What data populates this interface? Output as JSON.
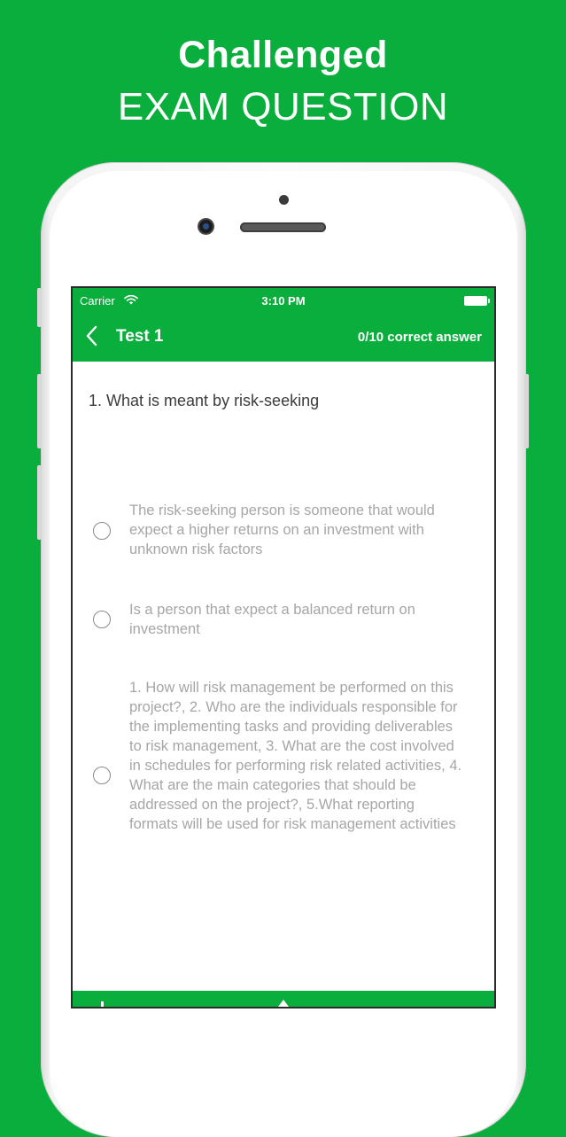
{
  "promo": {
    "line1": "Challenged",
    "line2": "EXAM QUESTION"
  },
  "status_bar": {
    "carrier": "Carrier",
    "time": "3:10 PM",
    "icons": [
      "wifi-icon",
      "battery-icon"
    ]
  },
  "nav": {
    "back_icon": "chevron-left-icon",
    "title": "Test 1",
    "score": "0/10 correct answer"
  },
  "question": {
    "text": "1. What is meant by risk-seeking"
  },
  "options": [
    {
      "text": "The risk-seeking person is someone that would expect a higher returns on an investment with unknown risk factors",
      "selected": false
    },
    {
      "text": "Is a person that expect a balanced return on investment",
      "selected": false
    },
    {
      "text": "1. How will risk management be performed on this project?, 2. Who are the individuals responsible for the implementing tasks and providing deliverables to risk management, 3. What are the cost involved in schedules for performing risk related activities, 4. What are the main categories that should be addressed on the project?, 5.What reporting formats will be used for risk management activities",
      "selected": false
    }
  ],
  "colors": {
    "brand_green": "#0aae3c",
    "question_text": "#3c3c3c",
    "option_text": "#a6a6a6"
  }
}
